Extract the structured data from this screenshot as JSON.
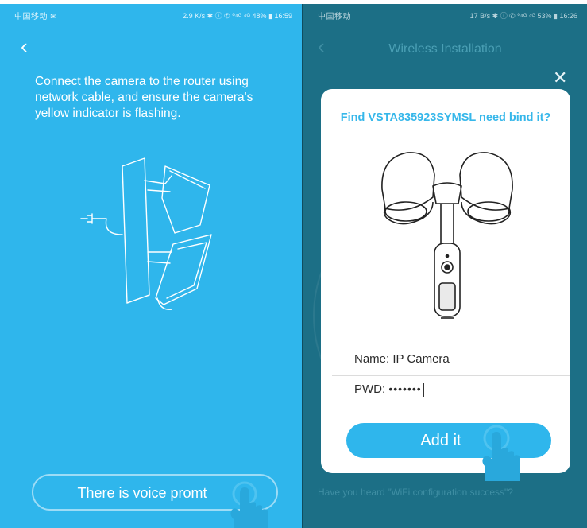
{
  "left_screen": {
    "status_left": "中国移动 ✉",
    "status_right": "2.9 K/s ✱ ⓘ ✆ ⁰⁴ᴳ ⁴ᴳ 48% ▮ 16:59",
    "back_icon": "back-arrow-icon",
    "instruction": "Connect the camera to the router using network cable, and ensure the camera's yellow indicator is flashing.",
    "voice_button": "There is voice promt",
    "colors": {
      "background": "#2fb6ec",
      "text": "#ffffff"
    }
  },
  "right_screen": {
    "status_left": "中国移动",
    "status_right": "17 B/s ✱ ⓘ ✆ ⁰⁴ᴳ ⁴ᴳ 53% ▮ 16:26",
    "back_icon": "back-arrow-icon",
    "title": "Wireless Installation",
    "close_icon": "close-icon",
    "dialog": {
      "title": "Find VSTA835923SYMSL need bind it?",
      "name_label": "Name: IP Camera",
      "pwd_label": "PWD:",
      "pwd_value": "•••••••",
      "add_button": "Add it"
    },
    "hint": "Have you heard \"WiFi configuration success\"?",
    "colors": {
      "background": "#1c6f86",
      "accent": "#2fb6ec",
      "dialog": "#ffffff"
    }
  }
}
